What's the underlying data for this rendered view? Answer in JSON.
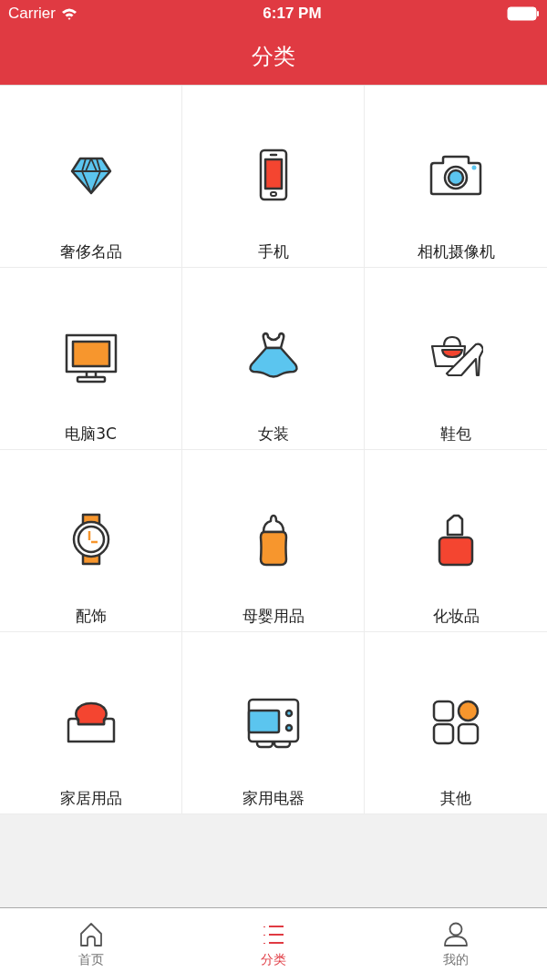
{
  "status_bar": {
    "carrier": "Carrier",
    "time": "6:17 PM"
  },
  "nav_bar": {
    "title": "分类"
  },
  "categories": [
    {
      "label": "奢侈名品"
    },
    {
      "label": "手机"
    },
    {
      "label": "相机摄像机"
    },
    {
      "label": "电脑3C"
    },
    {
      "label": "女装"
    },
    {
      "label": "鞋包"
    },
    {
      "label": "配饰"
    },
    {
      "label": "母婴用品"
    },
    {
      "label": "化妆品"
    },
    {
      "label": "家居用品"
    },
    {
      "label": "家用电器"
    },
    {
      "label": "其他"
    }
  ],
  "tab_bar": [
    {
      "label": "首页",
      "selected": false
    },
    {
      "label": "分类",
      "selected": true
    },
    {
      "label": "我的",
      "selected": false
    }
  ]
}
